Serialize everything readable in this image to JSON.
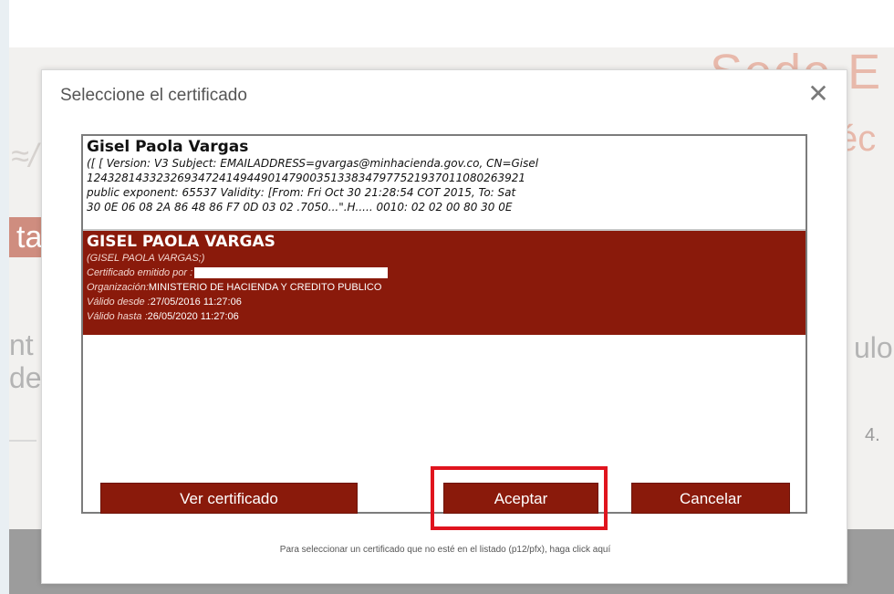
{
  "background": {
    "header_text_1": "Sede E",
    "header_text_2": "éc",
    "logo_text": "≈/",
    "tab_text": "ta",
    "left_text_1": "nt",
    "left_text_2": "de",
    "right_text": "ulo",
    "step_number": "4."
  },
  "dialog": {
    "title": "Seleccione el certificado",
    "close_icon": "close-icon",
    "certificates": [
      {
        "name": "Gisel Paola Vargas",
        "details": [
          "([ [ Version: V3 Subject: EMAILADDRESS=gvargas@minhacienda.gov.co, CN=Gisel",
          "124328143323269347241494490147900351338347977521937011080263921",
          "public exponent: 65537 Validity: [From: Fri Oct 30 21:28:54 COT 2015, To: Sat",
          "30 0E 06 08 2A 86 48 86 F7 0D 03 02 .7050...\".H..... 0010: 02 02 00 80 30 0E"
        ]
      },
      {
        "name": "GISEL PAOLA VARGAS",
        "subname": "(GISEL PAOLA VARGAS;)",
        "issued_by_label": "Certificado emitido por :",
        "organization_label": "Organización:",
        "organization": "MINISTERIO DE HACIENDA Y CREDITO PUBLICO",
        "valid_from_label": "Válido desde :",
        "valid_from": "27/05/2016 11:27:06",
        "valid_to_label": "Válido hasta :",
        "valid_to": "26/05/2020 11:27:06"
      }
    ],
    "buttons": {
      "view": "Ver certificado",
      "accept": "Aceptar",
      "cancel": "Cancelar"
    },
    "help_text": "Para seleccionar un certificado que no esté en el listado (p12/pfx), haga click aquí"
  },
  "colors": {
    "accent": "#8a1a0b",
    "highlight": "#e0141e"
  }
}
